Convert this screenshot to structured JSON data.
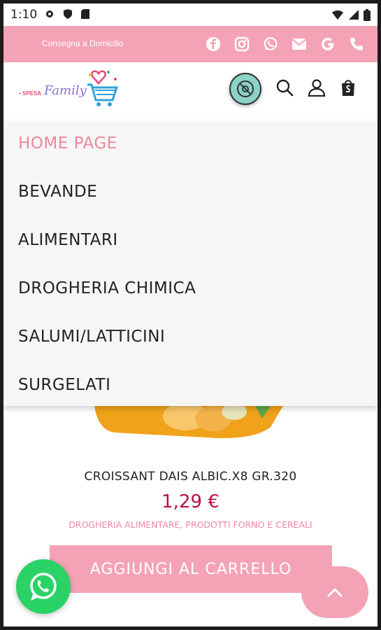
{
  "status_bar": {
    "time": "1:10"
  },
  "promo_bar": {
    "text": "Consegna a Domicilio"
  },
  "logo": {
    "spesa": "• SPESA",
    "family": "Family"
  },
  "menu": {
    "items": [
      {
        "label": "HOME PAGE",
        "active": true
      },
      {
        "label": "BEVANDE"
      },
      {
        "label": "ALIMENTARI"
      },
      {
        "label": "DROGHERIA CHIMICA"
      },
      {
        "label": "SALUMI/LATTICINI"
      },
      {
        "label": "SURGELATI"
      }
    ]
  },
  "product": {
    "title": "CROISSANT DAIS ALBIC.X8 GR.320",
    "price": "1,29 €",
    "category": "DROGHERIA ALIMENTARE, PRODOTTI FORNO E CEREALI",
    "add_to_cart_label": "AGGIUNGI AL CARRELLO"
  },
  "colors": {
    "accent_pink": "#f4a3b6",
    "price_red": "#b5123e",
    "whatsapp_green": "#2bd366"
  }
}
